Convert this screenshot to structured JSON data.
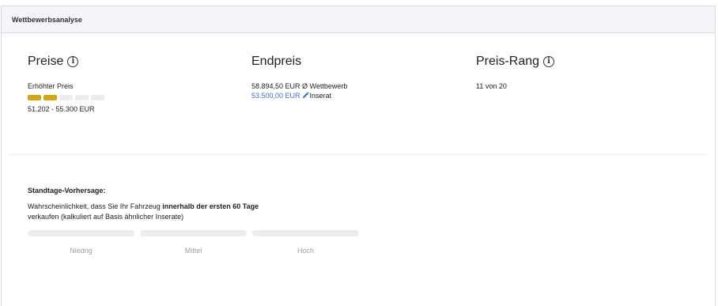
{
  "panel": {
    "title": "Wettbewerbsanalyse"
  },
  "preise": {
    "heading": "Preise",
    "rating_label": "Erhöhter Preis",
    "rating_level": 2,
    "rating_max": 5,
    "range": "51.202 - 55.300 EUR"
  },
  "endpreis": {
    "heading": "Endpreis",
    "competitor_line": "58.894,50 EUR Ø Wettbewerb",
    "listing_price": "53.500,00 EUR",
    "listing_suffix": "Inserat"
  },
  "rang": {
    "heading": "Preis-Rang",
    "value": "11 von 20"
  },
  "forecast": {
    "title": "Standtage-Vorhersage:",
    "desc_part1": "Wahrscheinlichkeit, dass Sie Ihr Fahrzeug ",
    "desc_bold": "innerhalb der ersten 60 Tage",
    "desc_part2": " verkaufen (kalkuliert auf Basis ähnlicher Inserate)",
    "levels": [
      "Niedrig",
      "Mittel",
      "Hoch"
    ]
  },
  "colors": {
    "accent_gold": "#d4a615",
    "link_blue": "#3b6fce",
    "header_bg": "#f3f5f8"
  },
  "icons": {
    "info": "info-circle-icon",
    "edit": "pencil-icon"
  }
}
